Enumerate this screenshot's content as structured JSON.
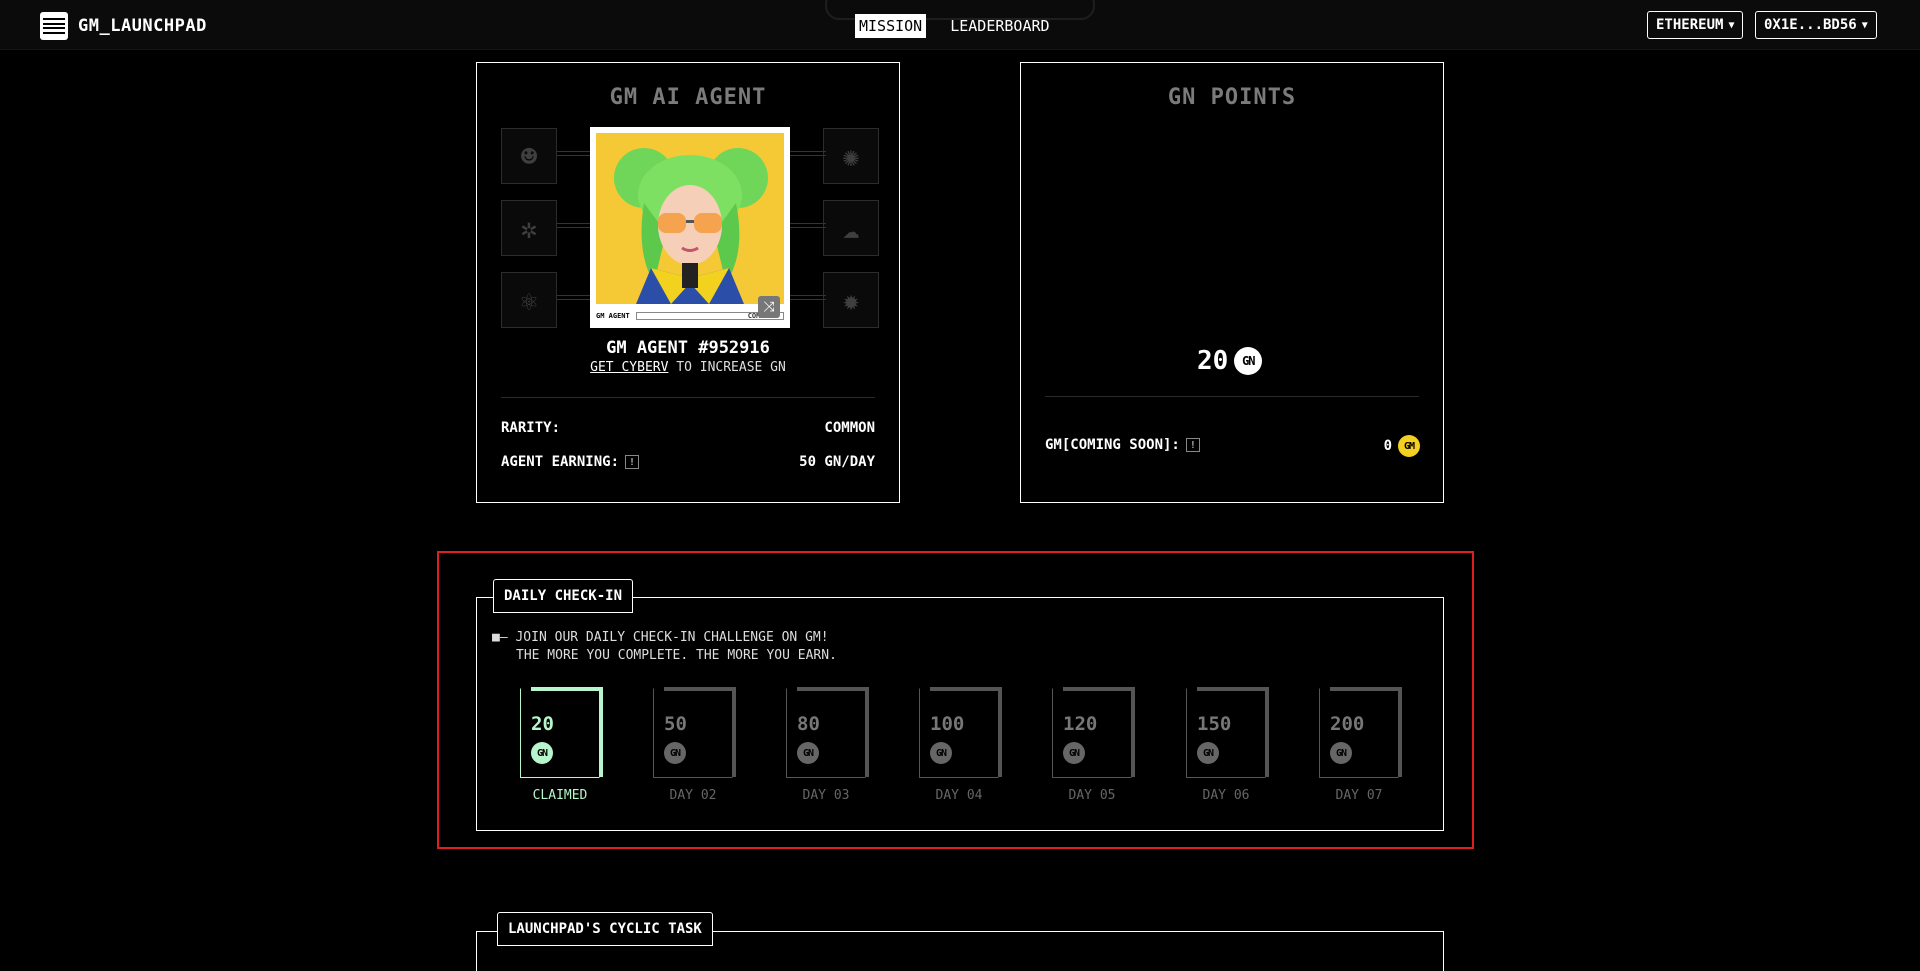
{
  "header": {
    "logo_text": "GM_LAUNCHPAD",
    "nav": [
      {
        "label": "MISSION",
        "active": true
      },
      {
        "label": "LEADERBOARD",
        "active": false
      }
    ],
    "network_label": "ETHEREUM",
    "wallet_label": "0X1E...BD56"
  },
  "agent_panel": {
    "title": "GM AI AGENT",
    "card_tag": "GM AGENT",
    "card_rarity": "COMMON",
    "agent_name": "GM AGENT #952916",
    "cta_link": "GET CYBERV",
    "cta_text": "TO INCREASE GN",
    "rarity_label": "RARITY:",
    "rarity_value": "COMMON",
    "earning_label": "AGENT EARNING:",
    "earning_value": "50 GN/DAY"
  },
  "points_panel": {
    "title": "GN POINTS",
    "value": "20",
    "coin": "GN",
    "gm_label": "GM[COMING SOON]:",
    "gm_value": "0",
    "gm_coin": "GM"
  },
  "checkin": {
    "tab_label": "DAILY CHECK-IN",
    "bullet": "■—",
    "line1": "JOIN OUR DAILY CHECK-IN CHALLENGE ON GM!",
    "line2": "THE MORE YOU COMPLETE. THE MORE YOU EARN.",
    "coin": "GN",
    "days": [
      {
        "value": "20",
        "label": "CLAIMED",
        "claimed": true
      },
      {
        "value": "50",
        "label": "DAY 02",
        "claimed": false
      },
      {
        "value": "80",
        "label": "DAY 03",
        "claimed": false
      },
      {
        "value": "100",
        "label": "DAY 04",
        "claimed": false
      },
      {
        "value": "120",
        "label": "DAY 05",
        "claimed": false
      },
      {
        "value": "150",
        "label": "DAY 06",
        "claimed": false
      },
      {
        "value": "200",
        "label": "DAY 07",
        "claimed": false
      }
    ]
  },
  "cyclic": {
    "tab_label": "LAUNCHPAD'S CYCLIC TASK"
  },
  "colors": {
    "accent_claimed": "#b7f5cd",
    "highlight_border": "#e01e1e",
    "gm_coin": "#f5d020"
  }
}
